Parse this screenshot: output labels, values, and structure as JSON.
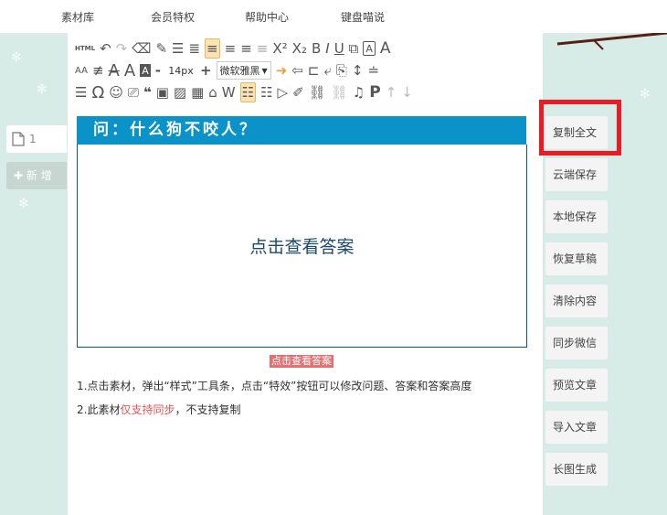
{
  "topnav": {
    "items": [
      "素材库",
      "会员特权",
      "帮助中心",
      "键盘喵说"
    ]
  },
  "left_panel": {
    "tab_label": "1",
    "add_label": "新 增"
  },
  "toolbar": {
    "font_size_value": "14px",
    "font_family": "微软雅黑",
    "html_label": "HTML",
    "superscript": "X²",
    "subscript": "X₂",
    "bold": "B",
    "italic": "I",
    "underline": "U",
    "font_letter": "A",
    "spacing": "AA",
    "minus": "-",
    "plus": "+",
    "omega": "Ω",
    "quote": "❝",
    "paragraph": "P"
  },
  "editor": {
    "question_header": "问：什么狗不咬人？",
    "answer_prompt": "点击查看答案",
    "reveal_link": "点击查看答案",
    "note1": "1.点击素材，弹出“样式”工具条，点击“特效”按钮可以修改问题、答案和答案高度",
    "note2_prefix": "2.此素材",
    "note2_red": "仅支持同步",
    "note2_suffix": "，不支持复制"
  },
  "actions": [
    "复制全文",
    "云端保存",
    "本地保存",
    "恢复草稿",
    "清除内容",
    "同步微信",
    "预览文章",
    "导入文章",
    "长图生成"
  ],
  "colors": {
    "header_blue": "#0b93c9",
    "highlight_red": "#e81c24",
    "link_red": "#e27272",
    "background": "#d7ece6"
  }
}
